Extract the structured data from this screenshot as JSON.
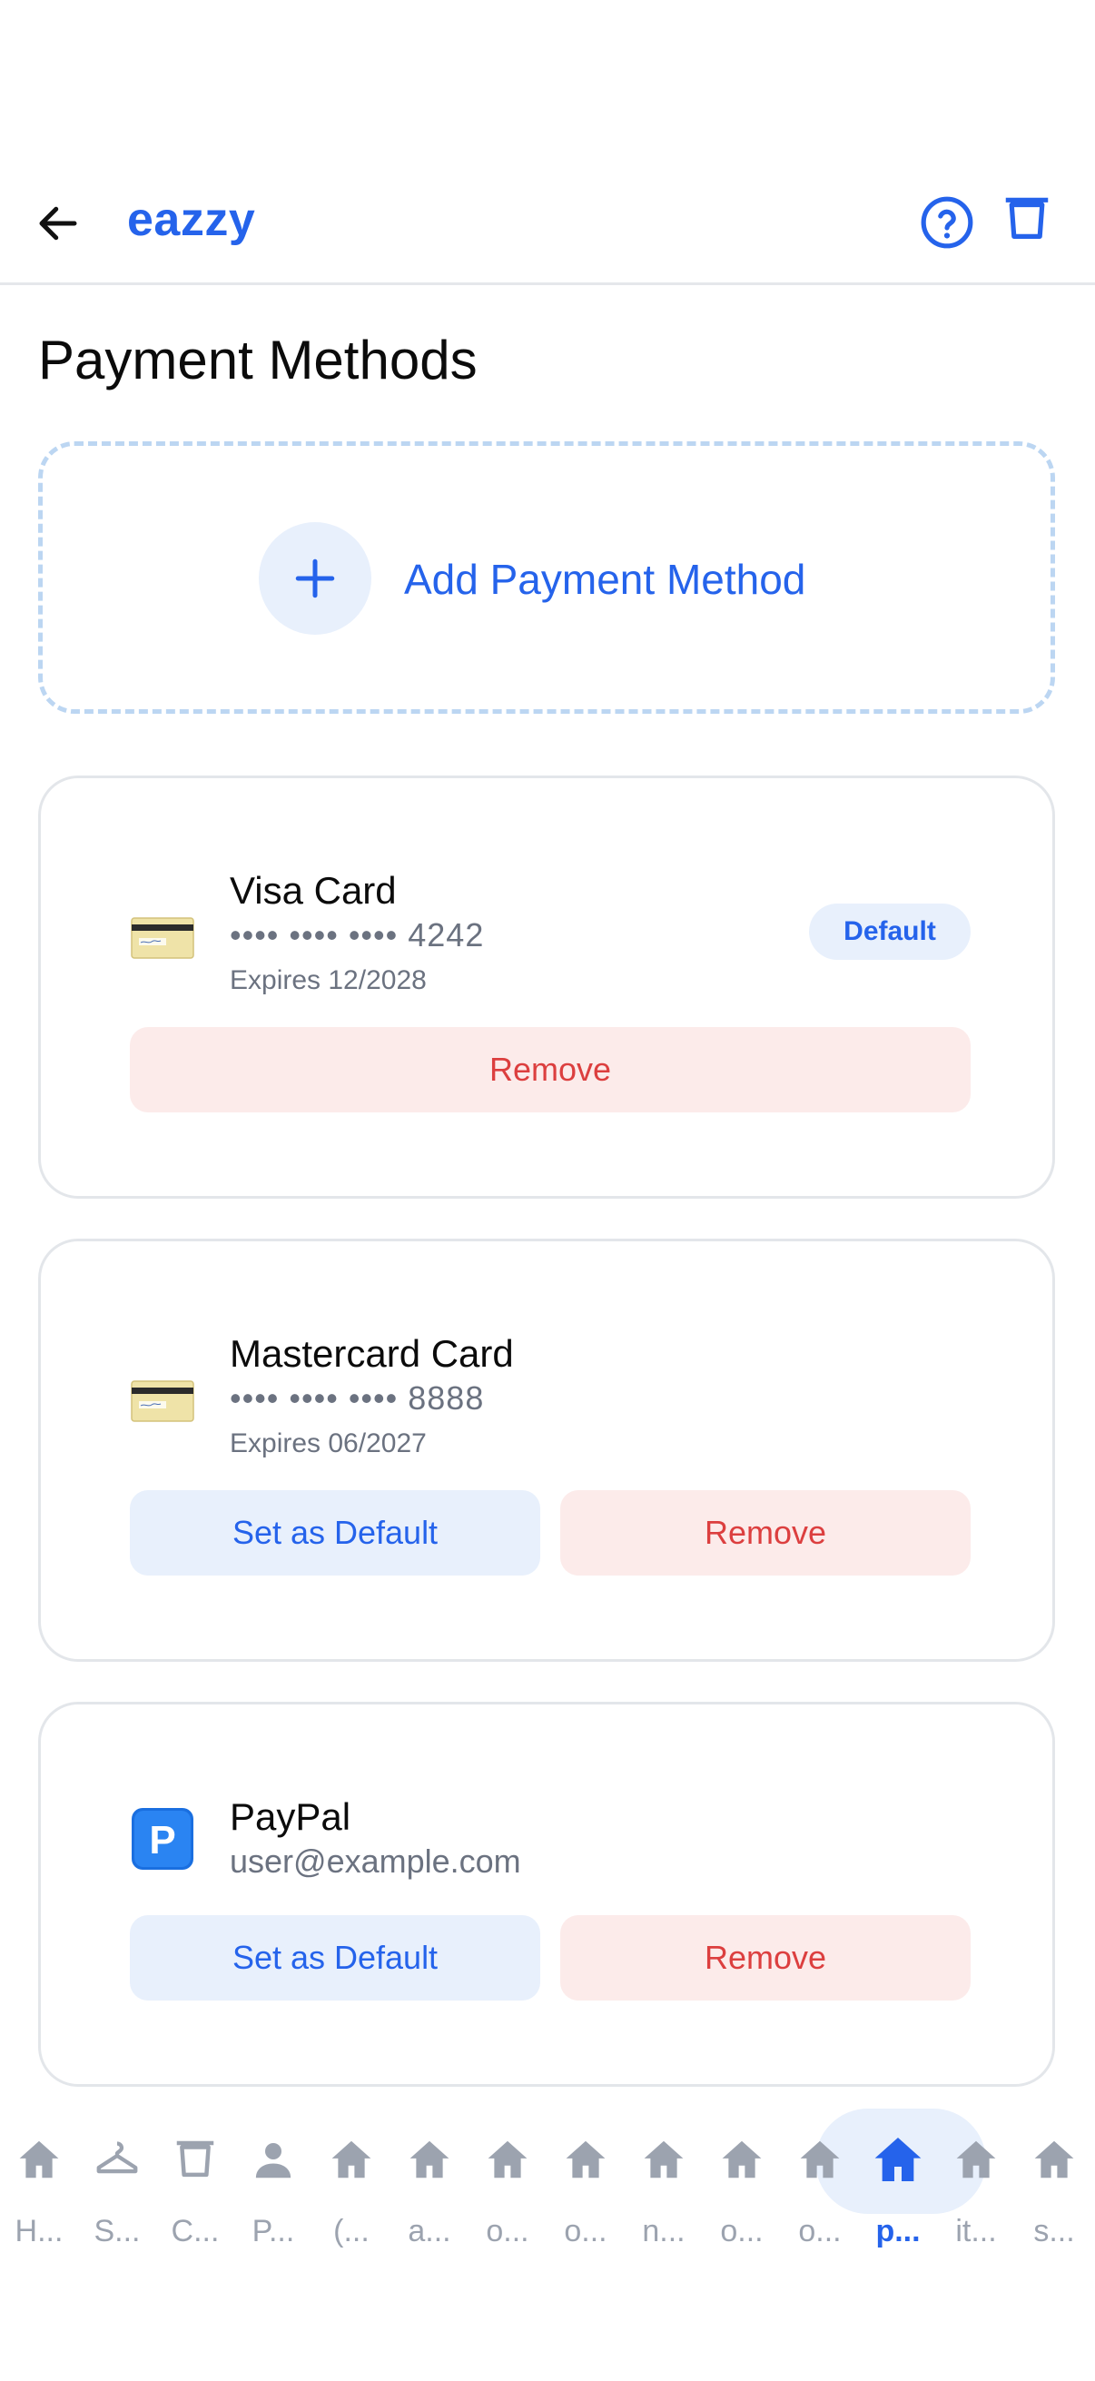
{
  "header": {
    "app_title": "eazzy",
    "back_icon": "arrow-left-icon",
    "help_icon": "help-circle-icon",
    "cart_icon": "cart-icon"
  },
  "page": {
    "title": "Payment Methods"
  },
  "add_method": {
    "label": "Add Payment Method",
    "icon": "plus-icon"
  },
  "payment_methods": [
    {
      "name": "Visa Card",
      "detail": "•••• •••• •••• 4242",
      "expiry": "Expires 12/2028",
      "icon": "credit-card-icon",
      "badge": "Default",
      "remove_label": "Remove"
    },
    {
      "name": "Mastercard Card",
      "detail": "•••• •••• •••• 8888",
      "expiry": "Expires 06/2027",
      "icon": "credit-card-icon",
      "set_default_label": "Set as Default",
      "remove_label": "Remove"
    },
    {
      "name": "PayPal",
      "detail": "user@example.com",
      "icon": "paypal-p-icon",
      "set_default_label": "Set as Default",
      "remove_label": "Remove"
    }
  ],
  "bottom_nav": {
    "items": [
      {
        "label": "H...",
        "icon": "home-icon"
      },
      {
        "label": "S...",
        "icon": "hanger-icon"
      },
      {
        "label": "C...",
        "icon": "cart-icon"
      },
      {
        "label": "P...",
        "icon": "person-icon"
      },
      {
        "label": "(...",
        "icon": "home-icon"
      },
      {
        "label": "a...",
        "icon": "home-icon"
      },
      {
        "label": "o...",
        "icon": "home-icon"
      },
      {
        "label": "o...",
        "icon": "home-icon"
      },
      {
        "label": "n...",
        "icon": "home-icon"
      },
      {
        "label": "o...",
        "icon": "home-icon"
      },
      {
        "label": "o...",
        "icon": "home-icon"
      },
      {
        "label": "p...",
        "icon": "home-icon",
        "active": true
      },
      {
        "label": "it...",
        "icon": "home-icon"
      },
      {
        "label": "s...",
        "icon": "home-icon"
      }
    ]
  },
  "colors": {
    "accent": "#2563eb",
    "accent_bg": "#e8f0fc",
    "danger": "#dc3f3f",
    "danger_bg": "#fcebea",
    "muted": "#9ca3af"
  }
}
